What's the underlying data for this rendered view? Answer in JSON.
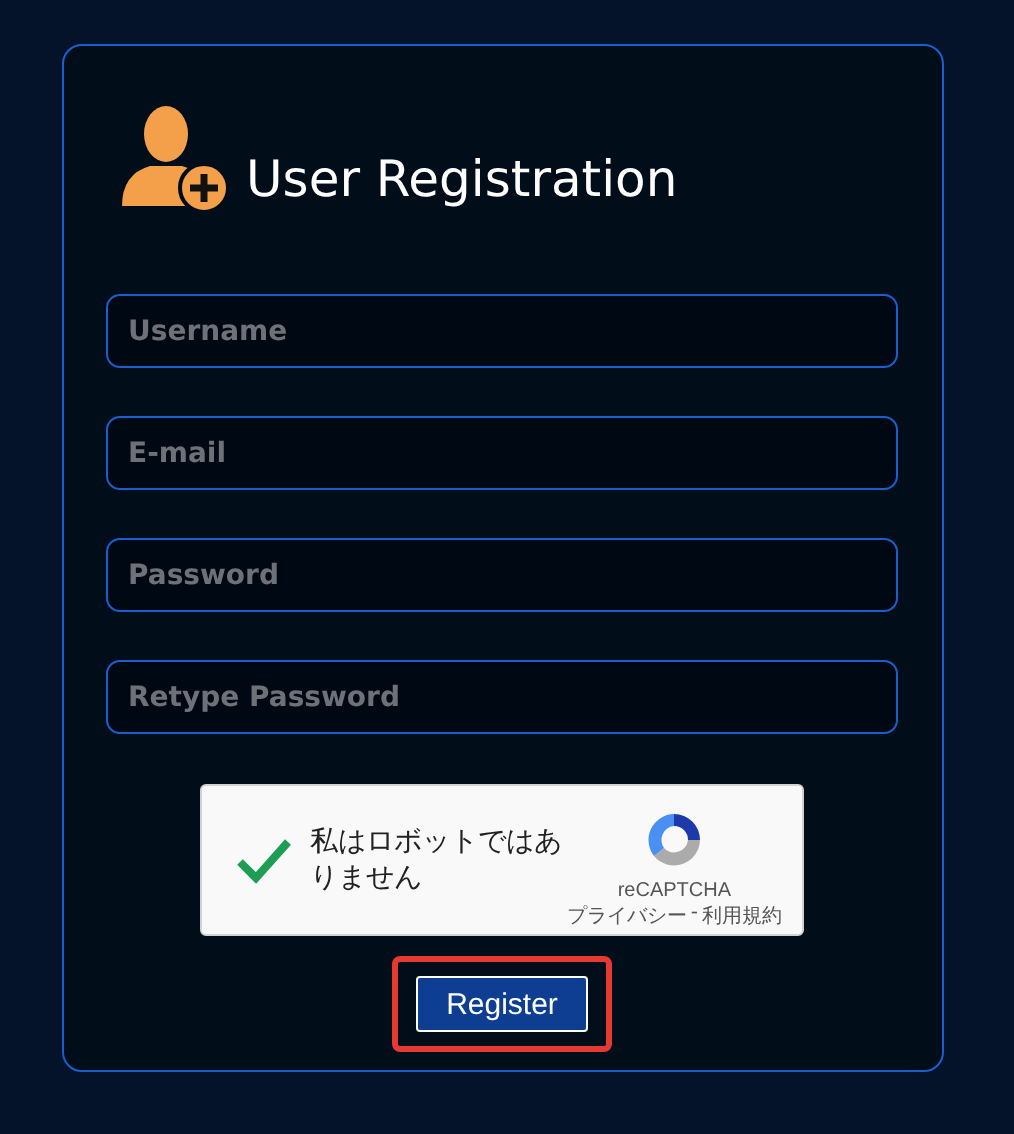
{
  "form": {
    "title": "User Registration",
    "fields": [
      {
        "placeholder": "Username"
      },
      {
        "placeholder": "E-mail"
      },
      {
        "placeholder": "Password"
      },
      {
        "placeholder": "Retype Password"
      }
    ],
    "captcha": {
      "checked": true,
      "label": "私はロボットではありません",
      "brand": "reCAPTCHA",
      "privacy": "プライバシー",
      "separator": "-",
      "terms": "利用規約"
    },
    "submit": {
      "label": "Register",
      "highlighted": true
    }
  }
}
